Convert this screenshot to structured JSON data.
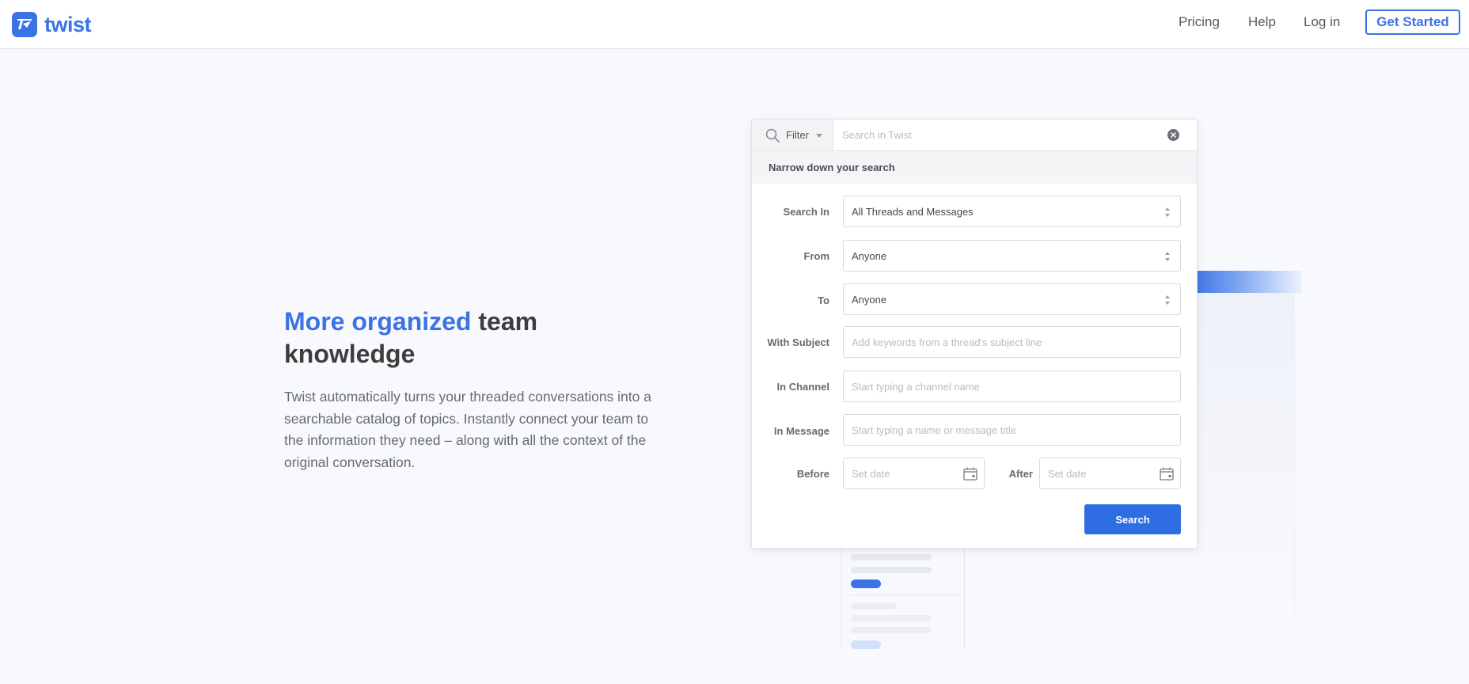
{
  "nav": {
    "brand": "twist",
    "links": [
      "Pricing",
      "Help",
      "Log in"
    ],
    "cta": "Get Started",
    "accent_color": "#3b73e5"
  },
  "hero": {
    "title_accent": "More organized",
    "title_rest": " team knowledge",
    "description": "Twist automatically turns your threaded conversations into a searchable catalog of topics. Instantly connect your team to the information they need – along with all the context of the original conversation."
  },
  "search_panel": {
    "filter_label": "Filter",
    "search_placeholder": "Search in Twist",
    "narrow_heading": "Narrow down your search",
    "search_in": {
      "label": "Search In",
      "value": "All Threads and Messages"
    },
    "from": {
      "label": "From",
      "value": "Anyone"
    },
    "to": {
      "label": "To",
      "value": "Anyone"
    },
    "with_subject": {
      "label": "With Subject",
      "placeholder": "Add keywords from a thread's subject line"
    },
    "in_channel": {
      "label": "In Channel",
      "placeholder": "Start typing a channel name"
    },
    "in_message": {
      "label": "In Message",
      "placeholder": "Start typing a name or message title"
    },
    "before": {
      "label": "Before",
      "placeholder": "Set date"
    },
    "after": {
      "label": "After",
      "placeholder": "Set date"
    },
    "submit": "Search"
  }
}
